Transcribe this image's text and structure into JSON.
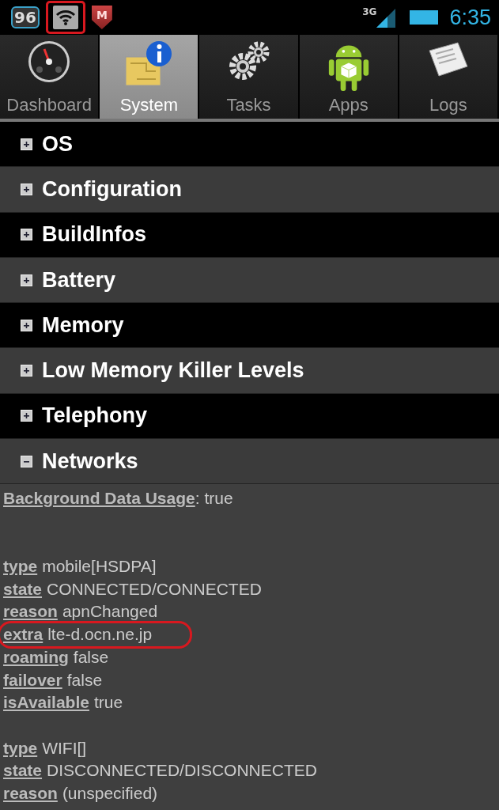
{
  "status_bar": {
    "badge": "96",
    "wifi_highlighted": true,
    "shield_letter": "M",
    "network": "3G",
    "time": "6:35"
  },
  "tabs": [
    {
      "label": "Dashboard",
      "kind": "gauge",
      "selected": false
    },
    {
      "label": "System",
      "kind": "info",
      "selected": true
    },
    {
      "label": "Tasks",
      "kind": "gears",
      "selected": false
    },
    {
      "label": "Apps",
      "kind": "android",
      "selected": false
    },
    {
      "label": "Logs",
      "kind": "paper",
      "selected": false
    }
  ],
  "sections": [
    {
      "title": "OS",
      "expanded": false
    },
    {
      "title": "Configuration",
      "expanded": false
    },
    {
      "title": "BuildInfos",
      "expanded": false
    },
    {
      "title": "Battery",
      "expanded": false
    },
    {
      "title": "Memory",
      "expanded": false
    },
    {
      "title": "Low Memory Killer Levels",
      "expanded": false
    },
    {
      "title": "Telephony",
      "expanded": false
    },
    {
      "title": "Networks",
      "expanded": true
    }
  ],
  "networks": {
    "background": {
      "key": "Background Data Usage",
      "value": ": true"
    },
    "groups": [
      [
        {
          "key": "type",
          "value": "mobile[HSDPA]",
          "highlighted": false
        },
        {
          "key": "state",
          "value": "CONNECTED/CONNECTED",
          "highlighted": false
        },
        {
          "key": "reason",
          "value": "apnChanged",
          "highlighted": false
        },
        {
          "key": "extra",
          "value": "lte-d.ocn.ne.jp",
          "highlighted": true
        },
        {
          "key": "roaming",
          "value": "false",
          "highlighted": false
        },
        {
          "key": "failover",
          "value": "false",
          "highlighted": false
        },
        {
          "key": "isAvailable",
          "value": "true",
          "highlighted": false
        }
      ],
      [
        {
          "key": "type",
          "value": "WIFI[]",
          "highlighted": false
        },
        {
          "key": "state",
          "value": "DISCONNECTED/DISCONNECTED",
          "highlighted": false
        },
        {
          "key": "reason",
          "value": "(unspecified)",
          "highlighted": false
        }
      ]
    ]
  }
}
